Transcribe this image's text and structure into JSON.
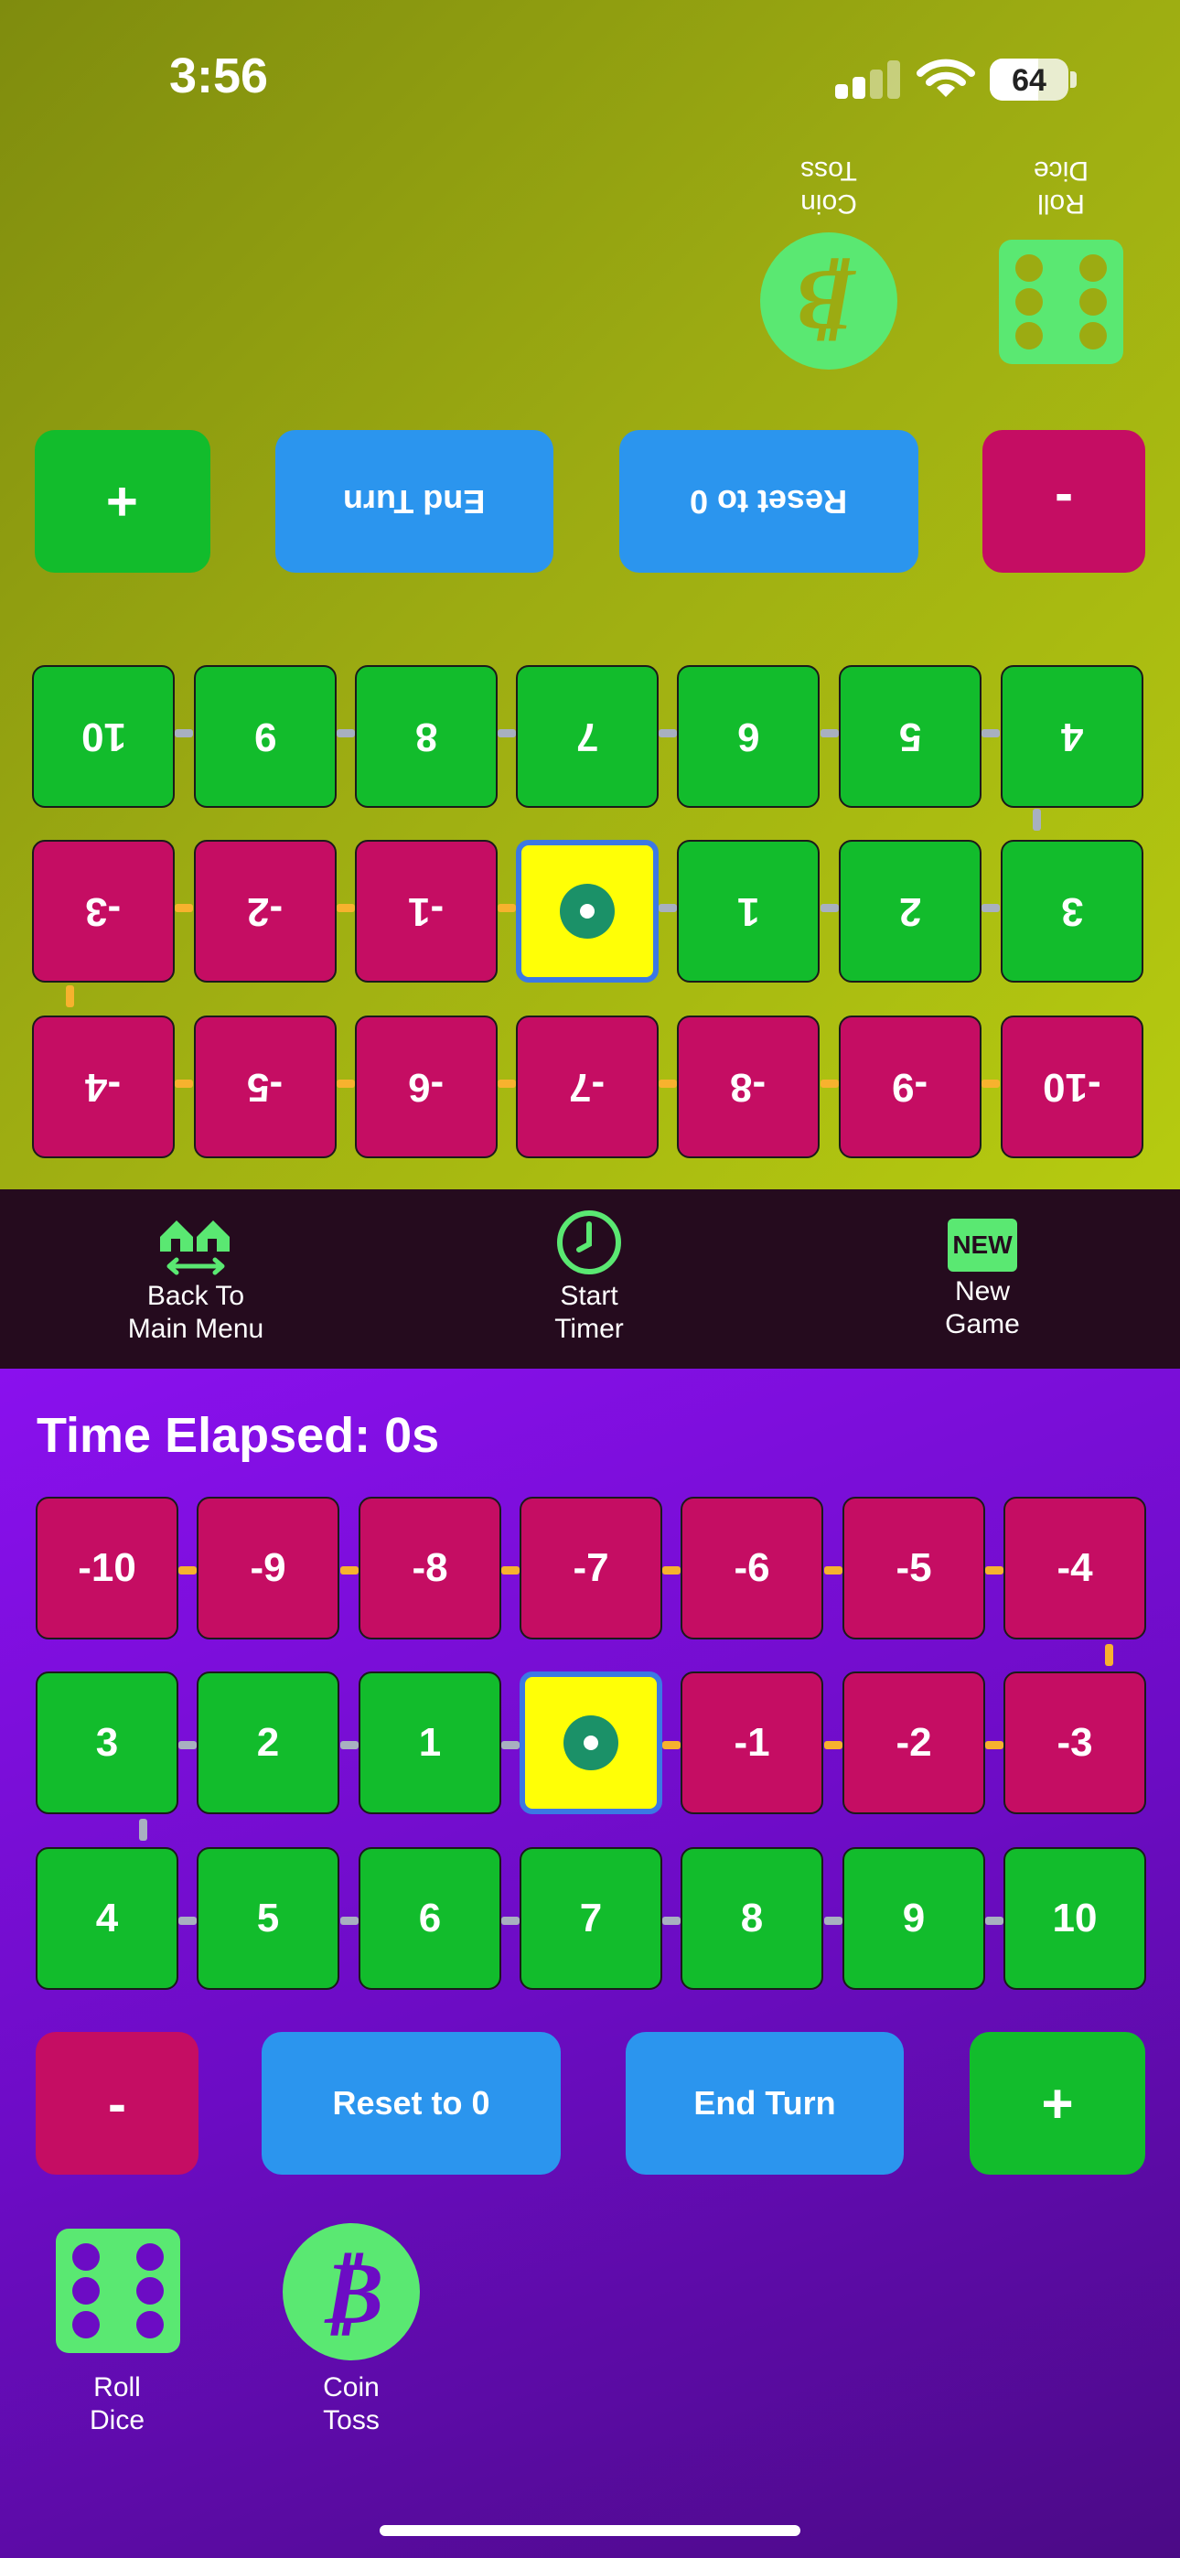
{
  "status_bar": {
    "time": "3:56",
    "battery": "64"
  },
  "top_player": {
    "coin_toss_label": "Coin\nToss",
    "roll_dice_label": "Roll\nDice",
    "coin_symbol": "₿",
    "plus_label": "+",
    "end_turn_label": "End Turn",
    "reset_label": "Reset to 0",
    "minus_label": "-",
    "rows": [
      [
        "10",
        "9",
        "8",
        "7",
        "6",
        "5",
        "4"
      ],
      [
        "-3",
        "-2",
        "-1",
        "",
        "1",
        "2",
        "3"
      ],
      [
        "-4",
        "-5",
        "-6",
        "-7",
        "-8",
        "-9",
        "-10"
      ]
    ]
  },
  "nav": {
    "back": "Back To\nMain Menu",
    "timer": "Start\nTimer",
    "new_game": "New\nGame",
    "new_badge": "NEW"
  },
  "bottom_player": {
    "time_elapsed": "Time Elapsed: 0s",
    "rows": [
      [
        "-10",
        "-9",
        "-8",
        "-7",
        "-6",
        "-5",
        "-4"
      ],
      [
        "3",
        "2",
        "1",
        "",
        "-1",
        "-2",
        "-3"
      ],
      [
        "4",
        "5",
        "6",
        "7",
        "8",
        "9",
        "10"
      ]
    ],
    "minus_label": "-",
    "reset_label": "Reset to 0",
    "end_turn_label": "End Turn",
    "plus_label": "+",
    "roll_dice_label": "Roll\nDice",
    "coin_toss_label": "Coin\nToss",
    "coin_symbol": "₿"
  },
  "colors": {
    "positive": "#12bc2c",
    "negative": "#c50d63",
    "zero": "#ffff06",
    "button_blue": "#2b95ee",
    "accent_green": "#5ae872"
  }
}
